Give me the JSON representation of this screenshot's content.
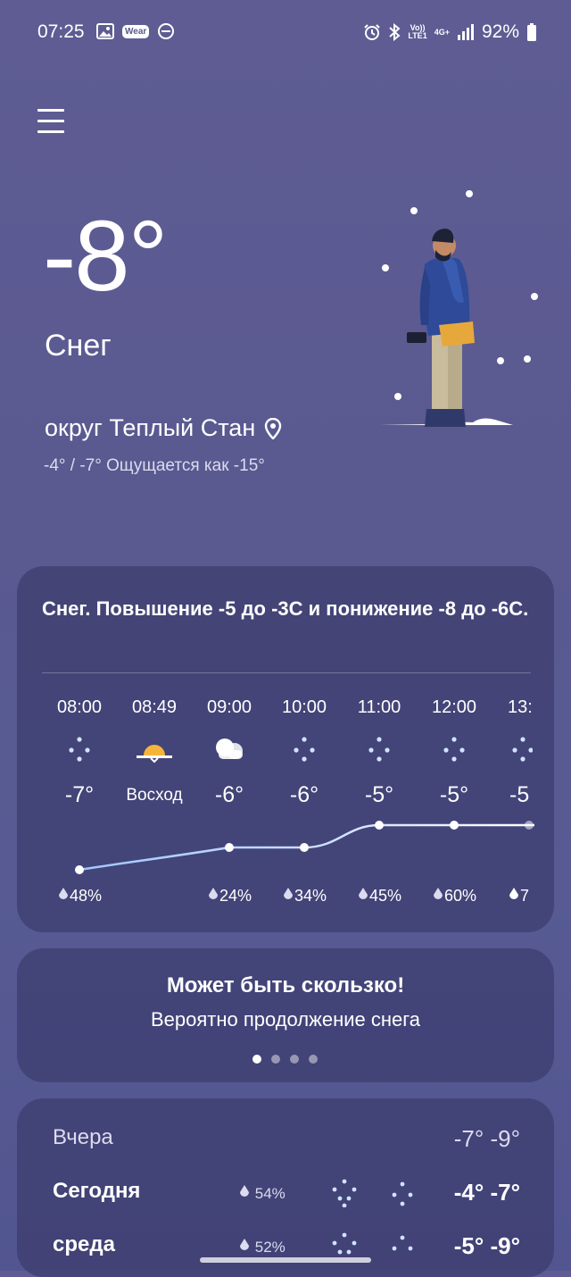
{
  "status_bar": {
    "time": "07:25",
    "wear_label": "Wear",
    "lte_top": "Vo))",
    "lte_bottom": "LTE1",
    "net": "4G+",
    "battery": "92%"
  },
  "current": {
    "temperature": "-8°",
    "condition": "Снег",
    "location": "округ Теплый Стан",
    "minmax": "-4° / -7° Ощущается как -15°"
  },
  "hourly_card": {
    "summary": "Снег. Повышение -5 до -3С и понижение -8 до -6С.",
    "hours": [
      {
        "time": "08:00",
        "icon": "snow-icon",
        "temp": "-7°",
        "precip": "48%"
      },
      {
        "time": "08:49",
        "icon": "sunrise-icon",
        "temp": "Восход",
        "precip": ""
      },
      {
        "time": "09:00",
        "icon": "cloudy-icon",
        "temp": "-6°",
        "precip": "24%"
      },
      {
        "time": "10:00",
        "icon": "snow-icon",
        "temp": "-6°",
        "precip": "34%"
      },
      {
        "time": "11:00",
        "icon": "snow-icon",
        "temp": "-5°",
        "precip": "45%"
      },
      {
        "time": "12:00",
        "icon": "snow-icon",
        "temp": "-5°",
        "precip": "60%"
      },
      {
        "time": "13:",
        "icon": "snow-icon",
        "temp": "-5",
        "precip": "7"
      }
    ]
  },
  "alert_card": {
    "title": "Может быть скользко!",
    "subtitle": "Вероятно продолжение снега",
    "pages": 4,
    "active_page": 0
  },
  "daily": [
    {
      "name": "Вчера",
      "precip": "",
      "temps": "-7° -9°"
    },
    {
      "name": "Сегодня",
      "precip": "54%",
      "temps": "-4° -7°"
    },
    {
      "name": "среда",
      "precip": "52%",
      "temps": "-5° -9°"
    }
  ],
  "colors": {
    "background": "#5a5990",
    "card": "#3c3c6e",
    "graph_line": "#ffffff",
    "graph_cold": "#9fc6ff",
    "sun": "#f5b53a"
  }
}
